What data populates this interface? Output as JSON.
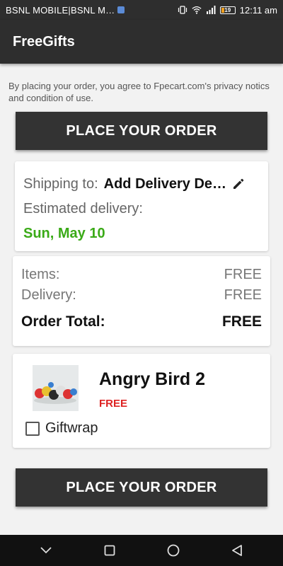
{
  "status_bar": {
    "carrier": "BSNL MOBILE|BSNL M…",
    "battery": "19",
    "time": "12:11 am"
  },
  "app": {
    "title": "FreeGifts"
  },
  "notice": "By placing your order, you agree to Fpecart.com's privacy notics and condition of use.",
  "place_order_label": "PLACE YOUR ORDER",
  "shipping": {
    "label": "Shipping to:",
    "value": "Add Delivery De…",
    "estimated_label": "Estimated delivery:",
    "estimated_date": "Sun, May 10"
  },
  "summary": {
    "items_label": "Items:",
    "items_value": "FREE",
    "delivery_label": "Delivery:",
    "delivery_value": "FREE",
    "total_label": "Order Total:",
    "total_value": "FREE"
  },
  "item": {
    "name": "Angry Bird 2",
    "price": "FREE",
    "giftwrap_label": "Giftwrap",
    "giftwrap_checked": false
  },
  "colors": {
    "bar": "#2e2e2e",
    "button": "#333333",
    "date_green": "#3aaa17",
    "price_red": "#dd2222"
  }
}
